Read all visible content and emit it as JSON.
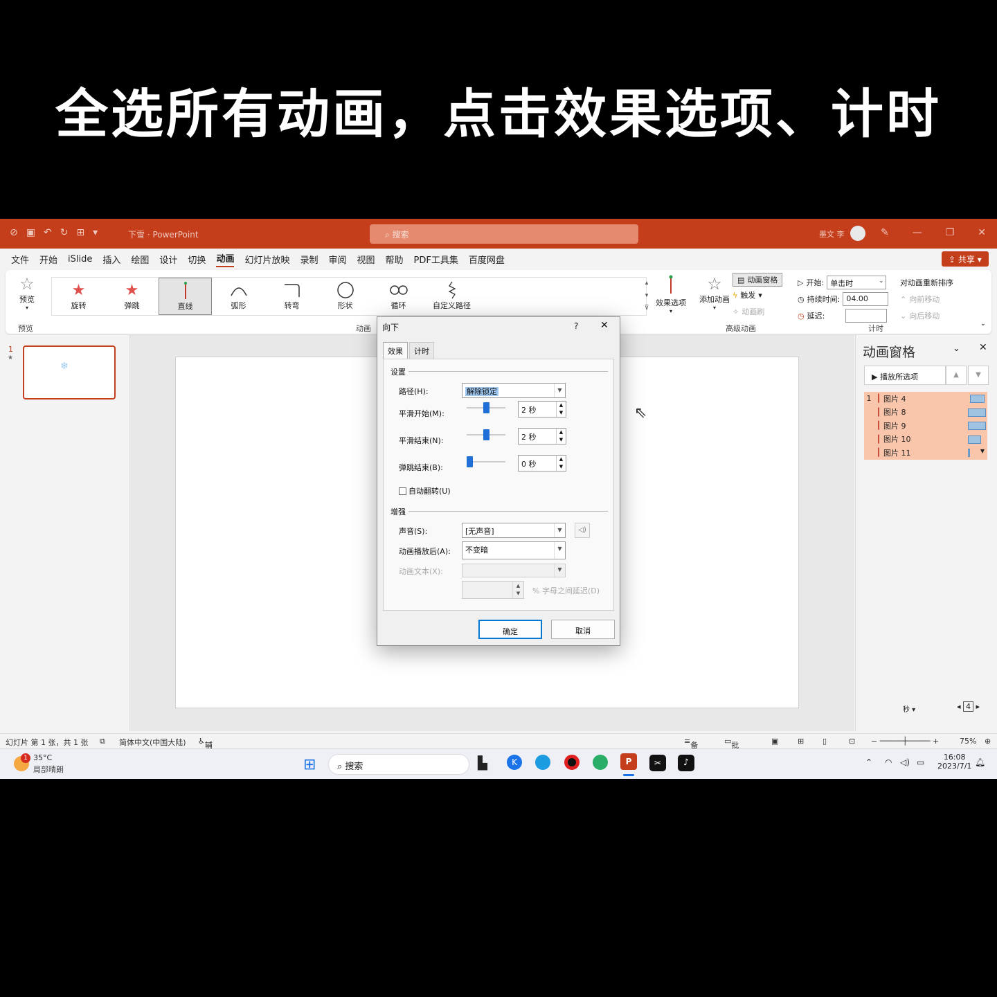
{
  "caption": "全选所有动画，点击效果选项、计时",
  "titlebar": {
    "doc_name": "下雪",
    "app": "PowerPoint",
    "search_placeholder": "搜索",
    "user": "墨文 李"
  },
  "menu": {
    "items": [
      "文件",
      "开始",
      "iSlide",
      "插入",
      "绘图",
      "设计",
      "切换",
      "动画",
      "幻灯片放映",
      "录制",
      "审阅",
      "视图",
      "帮助",
      "PDF工具集",
      "百度网盘"
    ],
    "active": "动画",
    "share": "共享"
  },
  "ribbon": {
    "preview": "预览",
    "preview_group": "预览",
    "gallery": [
      {
        "label": "旋转",
        "icon": "spin-star-icon"
      },
      {
        "label": "弹跳",
        "icon": "bounce-star-icon"
      },
      {
        "label": "直线",
        "icon": "line-path-icon"
      },
      {
        "label": "弧形",
        "icon": "arc-path-icon"
      },
      {
        "label": "转弯",
        "icon": "turn-path-icon"
      },
      {
        "label": "形状",
        "icon": "shape-path-icon"
      },
      {
        "label": "循环",
        "icon": "loop-path-icon"
      },
      {
        "label": "自定义路径",
        "icon": "custom-path-icon"
      }
    ],
    "gallery_selected": "直线",
    "anim_group": "动画",
    "effect_options": "效果选项",
    "add_animation": "添加动画",
    "animation_pane": "动画窗格",
    "trigger": "触发",
    "anim_painter": "动画刷",
    "advanced_group": "高级动画",
    "start_label": "开始:",
    "start_value": "单击时",
    "duration_label": "持续时间:",
    "duration_value": "04.00",
    "delay_label": "延迟:",
    "delay_value": "",
    "timing_group": "计时",
    "reorder": "对动画重新排序",
    "move_earlier": "向前移动",
    "move_later": "向后移动"
  },
  "slides": {
    "number": "1"
  },
  "anim_pane": {
    "title": "动画窗格",
    "play": "播放所选项",
    "items": [
      {
        "num": "1",
        "name": "图片 4",
        "bar_start": 0.86,
        "bar_len": 0.12
      },
      {
        "num": "",
        "name": "图片 8",
        "bar_start": 0.84,
        "bar_len": 0.15
      },
      {
        "num": "",
        "name": "图片 9",
        "bar_start": 0.84,
        "bar_len": 0.15
      },
      {
        "num": "",
        "name": "图片 10",
        "bar_start": 0.84,
        "bar_len": 0.11
      },
      {
        "num": "",
        "name": "图片 11",
        "bar_start": 0.84,
        "bar_len": 0.02
      }
    ],
    "seconds": "秒",
    "page": "4"
  },
  "dialog": {
    "title": "向下",
    "help": "?",
    "tabs": [
      "效果",
      "计时"
    ],
    "settings_header": "设置",
    "path_label": "路径(H):",
    "path_value": "解除锁定",
    "smooth_start_label": "平滑开始(M):",
    "smooth_start_value": "2 秒",
    "smooth_start_level": 0.5,
    "smooth_end_label": "平滑结束(N):",
    "smooth_end_value": "2 秒",
    "smooth_end_level": 0.5,
    "bounce_end_label": "弹跳结束(B):",
    "bounce_end_value": "0 秒",
    "bounce_end_level": 0.0,
    "auto_reverse_label": "自动翻转(U)",
    "enhance_header": "增强",
    "sound_label": "声音(S):",
    "sound_value": "[无声音]",
    "after_label": "动画播放后(A):",
    "after_value": "不变暗",
    "text_label": "动画文本(X):",
    "text_value": "",
    "delay_between": "% 字母之间延迟(D)",
    "ok": "确定",
    "cancel": "取消"
  },
  "statusbar": {
    "slide_info": "幻灯片 第 1 张，共 1 张",
    "language": "简体中文(中国大陆)",
    "accessibility": "辅助功能: 调查",
    "notes": "备注",
    "comments": "批注",
    "zoom": "75%"
  },
  "taskbar": {
    "weather_temp": "35°C",
    "weather_desc": "局部晴朗",
    "badge": "1",
    "search": "搜索",
    "time": "16:08",
    "date": "2023/7/1"
  }
}
